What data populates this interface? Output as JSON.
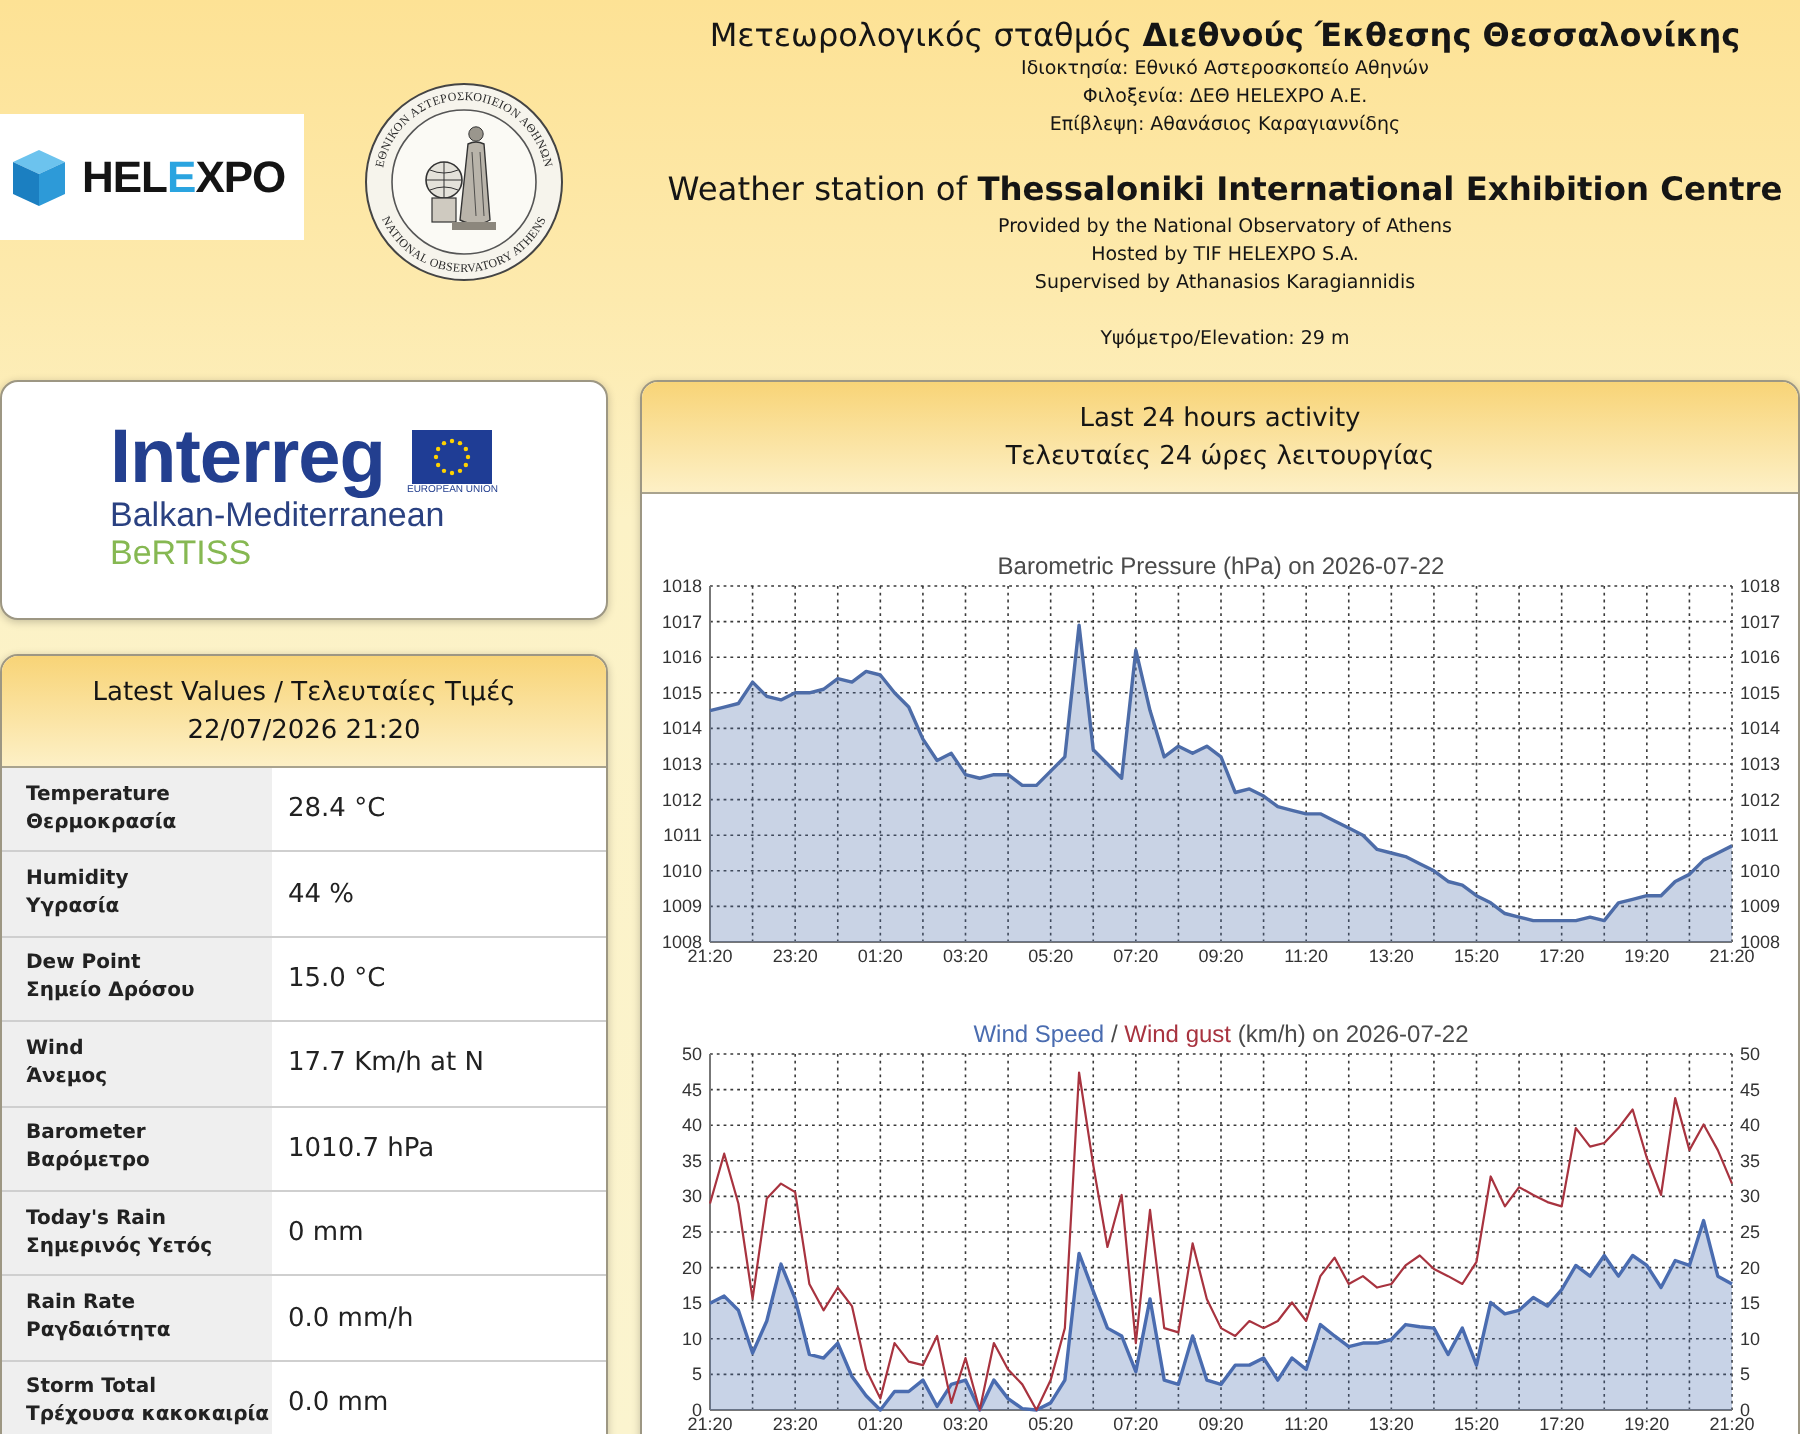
{
  "header": {
    "logo": {
      "text_parts": [
        {
          "text": "HEL",
          "accent": false
        },
        {
          "text": "E",
          "accent": true
        },
        {
          "text": "XPO",
          "accent": false
        }
      ]
    },
    "seal": {
      "top_text": "ΕΘΝΙΚΟΝ ΑΣΤΕΡΟΣΚΟΠΕΙΟΝ ΑΘΗΝΩΝ",
      "bottom_text": "NATIONAL OBSERVATORY ATHENS"
    },
    "title_el": "Μετεωρολογικός σταθμός **Διεθνούς Έκθεσης Θεσσαλονίκης**",
    "lines_el": [
      "Ιδιοκτησία: Εθνικό Αστεροσκοπείο Αθηνών",
      "Φιλοξενία: ΔΕΘ HELEXPO Α.Ε.",
      "Επίβλεψη: Αθανάσιος Καραγιαννίδης"
    ],
    "title_en": "Weather station of **Thessaloniki International Exhibition Centre**",
    "lines_en": [
      "Provided by the National Observatory of Athens",
      "Hosted by TIF HELEXPO S.A.",
      "Supervised by Athanasios Karagiannidis"
    ],
    "elevation": "Υψόμετρο/Elevation: 29 m"
  },
  "sponsor": {
    "name": "Interreg",
    "flag_caption": "EUROPEAN UNION",
    "programme": "Balkan-Mediterranean",
    "project": "BeRTISS"
  },
  "latest_values": {
    "title": "Latest Values / Τελευταίες Τιμές",
    "timestamp": "22/07/2026 21:20",
    "rows": [
      {
        "label_en": "Temperature",
        "label_el": "Θερμοκρασία",
        "value": "28.4 °C"
      },
      {
        "label_en": "Humidity",
        "label_el": "Υγρασία",
        "value": "44 %"
      },
      {
        "label_en": "Dew Point",
        "label_el": "Σημείο Δρόσου",
        "value": "15.0 °C"
      },
      {
        "label_en": "Wind",
        "label_el": "Άνεμος",
        "value": "17.7 Km/h at N"
      },
      {
        "label_en": "Barometer",
        "label_el": "Βαρόμετρο",
        "value": "1010.7 hPa"
      },
      {
        "label_en": "Today's Rain",
        "label_el": "Σημερινός Υετός",
        "value": "0 mm"
      },
      {
        "label_en": "Rain Rate",
        "label_el": "Ραγδαιότητα",
        "value": "0.0 mm/h"
      },
      {
        "label_en": "Storm Total",
        "label_el": "Τρέχουσα κακοκαιρία",
        "value": "0.0 mm"
      }
    ]
  },
  "activity": {
    "title_en": "Last 24 hours activity",
    "title_el": "Τελευταίες 24 ώρες λειτουργίας",
    "charts": [
      {
        "right_yticks": [
          "1018",
          "1017",
          "1016",
          "1015",
          "1014",
          "1013",
          "1012",
          "1011",
          "1010",
          "1009",
          "1008"
        ],
        "chart_data": {
          "type": "area",
          "title": "Barometric Pressure (hPa) on 2026-07-22",
          "grid": true,
          "categories": [
            "21:20",
            null,
            null,
            null,
            null,
            null,
            "23:20",
            null,
            null,
            null,
            null,
            null,
            "01:20",
            null,
            null,
            null,
            null,
            null,
            "03:20",
            null,
            null,
            null,
            null,
            null,
            "05:20",
            null,
            null,
            null,
            null,
            null,
            "07:20",
            null,
            null,
            null,
            null,
            null,
            "09:20",
            null,
            null,
            null,
            null,
            null,
            "11:20",
            null,
            null,
            null,
            null,
            null,
            "13:20",
            null,
            null,
            null,
            null,
            null,
            "15:20",
            null,
            null,
            null,
            null,
            null,
            "17:20",
            null,
            null,
            null,
            null,
            null,
            "19:20",
            null,
            null,
            null,
            null,
            null,
            "21:20"
          ],
          "values": [
            1014.5,
            1014.6,
            1014.7,
            1015.3,
            1014.9,
            1014.8,
            1015.0,
            1015.0,
            1015.1,
            1015.4,
            1015.3,
            1015.6,
            1015.5,
            1015.0,
            1014.6,
            1013.7,
            1013.1,
            1013.3,
            1012.7,
            1012.6,
            1012.7,
            1012.7,
            1012.4,
            1012.4,
            1012.8,
            1013.2,
            1016.9,
            1013.4,
            1013.0,
            1012.6,
            1016.2,
            1014.5,
            1013.2,
            1013.5,
            1013.3,
            1013.5,
            1013.2,
            1012.2,
            1012.3,
            1012.1,
            1011.8,
            1011.7,
            1011.6,
            1011.6,
            1011.4,
            1011.2,
            1011.0,
            1010.6,
            1010.5,
            1010.4,
            1010.2,
            1010.0,
            1009.7,
            1009.6,
            1009.3,
            1009.1,
            1008.8,
            1008.7,
            1008.6,
            1008.6,
            1008.6,
            1008.6,
            1008.7,
            1008.6,
            1009.1,
            1009.2,
            1009.3,
            1009.3,
            1009.7,
            1009.9,
            1010.3,
            1010.5,
            1010.7
          ],
          "ylim": [
            1008,
            1018
          ],
          "yticks": [
            1008,
            1009,
            1010,
            1011,
            1012,
            1013,
            1014,
            1015,
            1016,
            1017,
            1018
          ]
        }
      },
      {
        "right_yticks": [
          "50",
          "45",
          "40",
          "35",
          "30",
          "25",
          "20",
          "15",
          "10",
          "5",
          "0"
        ],
        "title_separator": "/",
        "title_suffix": "(km/h) on 2026-07-22",
        "chart_data": {
          "type": "area",
          "grid": true,
          "categories": [
            "21:20",
            null,
            null,
            null,
            null,
            null,
            "23:20",
            null,
            null,
            null,
            null,
            null,
            "01:20",
            null,
            null,
            null,
            null,
            null,
            "03:20",
            null,
            null,
            null,
            null,
            null,
            "05:20",
            null,
            null,
            null,
            null,
            null,
            "07:20",
            null,
            null,
            null,
            null,
            null,
            "09:20",
            null,
            null,
            null,
            null,
            null,
            "11:20",
            null,
            null,
            null,
            null,
            null,
            "13:20",
            null,
            null,
            null,
            null,
            null,
            "15:20",
            null,
            null,
            null,
            null,
            null,
            "17:20",
            null,
            null,
            null,
            null,
            null,
            "19:20",
            null,
            null,
            null,
            null,
            null,
            "21:20"
          ],
          "series": [
            {
              "name": "Wind Speed",
              "color": "#4a6cb0",
              "type": "area",
              "values": [
                15,
                16,
                14,
                8,
                12.5,
                20.5,
                15.6,
                7.8,
                7.3,
                9.4,
                4.7,
                2,
                0,
                2.6,
                2.6,
                4.2,
                0.5,
                3.6,
                4.2,
                0,
                4.2,
                1.6,
                0.2,
                0,
                1,
                4.2,
                22,
                16.7,
                11.5,
                10.4,
                5.4,
                15.6,
                4.2,
                3.6,
                10.4,
                4.2,
                3.6,
                6.3,
                6.3,
                7.3,
                4.2,
                7.3,
                5.7,
                12,
                10.4,
                8.9,
                9.4,
                9.4,
                9.9,
                12,
                11.7,
                11.5,
                7.8,
                11.5,
                6.3,
                15.1,
                13.5,
                14,
                15.8,
                14.6,
                16.9,
                20.3,
                18.8,
                21.7,
                18.8,
                21.7,
                20.3,
                17.2,
                21,
                20.3,
                26.6,
                18.8,
                17.7
              ]
            },
            {
              "name": "Wind gust",
              "color": "#a8333f",
              "type": "line",
              "values": [
                29,
                36,
                29,
                15.6,
                29.7,
                31.8,
                30.6,
                17.7,
                14,
                17.2,
                14.6,
                5.7,
                1.6,
                9.4,
                6.8,
                6.3,
                10.4,
                1,
                7.3,
                0,
                9.4,
                5.7,
                3.6,
                0,
                4.2,
                11.5,
                47.4,
                34.4,
                22.9,
                30.2,
                9.4,
                28.1,
                11.5,
                10.9,
                23.4,
                15.6,
                11.5,
                10.4,
                12.5,
                11.5,
                12.5,
                15.1,
                12.5,
                18.8,
                21.4,
                17.7,
                18.8,
                17.2,
                17.7,
                20.3,
                21.7,
                19.8,
                18.8,
                17.7,
                20.8,
                32.8,
                28.6,
                31.3,
                30.2,
                29.2,
                28.6,
                39.6,
                37,
                37.5,
                39.6,
                42.2,
                35.4,
                30.2,
                43.8,
                36.5,
                40.1,
                36.5,
                31.8
              ]
            }
          ],
          "ylim": [
            0,
            50
          ],
          "yticks": [
            0,
            5,
            10,
            15,
            20,
            25,
            30,
            35,
            40,
            45,
            50
          ]
        }
      }
    ]
  }
}
